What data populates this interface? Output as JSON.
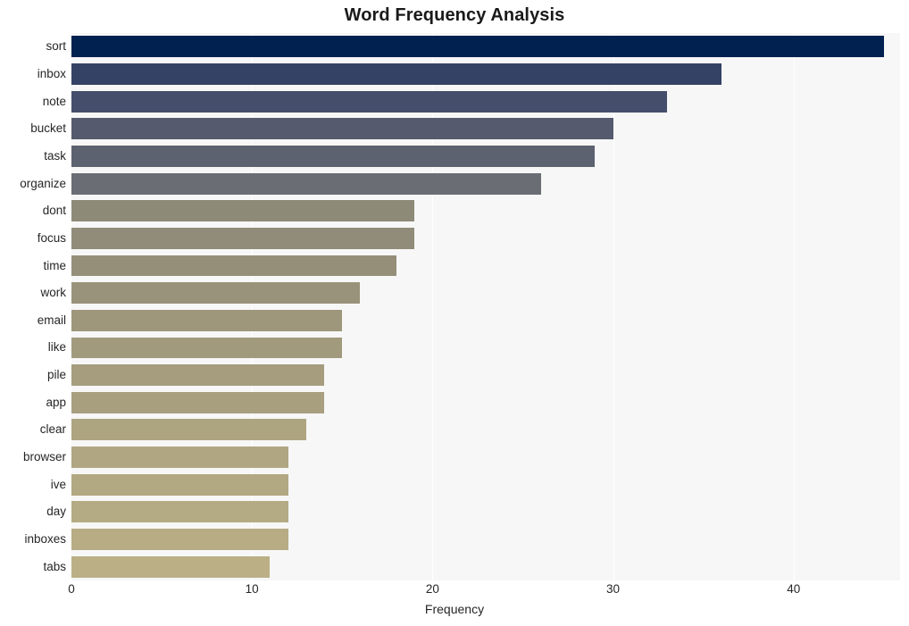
{
  "chart_data": {
    "type": "bar",
    "orientation": "horizontal",
    "title": "Word Frequency Analysis",
    "xlabel": "Frequency",
    "ylabel": "",
    "categories": [
      "sort",
      "inbox",
      "note",
      "bucket",
      "task",
      "organize",
      "dont",
      "focus",
      "time",
      "work",
      "email",
      "like",
      "pile",
      "app",
      "clear",
      "browser",
      "ive",
      "day",
      "inboxes",
      "tabs"
    ],
    "values": [
      45,
      36,
      33,
      30,
      29,
      26,
      19,
      19,
      18,
      16,
      15,
      15,
      14,
      14,
      13,
      12,
      12,
      12,
      12,
      11
    ],
    "bar_colors": [
      "#012151",
      "#344265",
      "#454f6c",
      "#555a6e",
      "#5d6270",
      "#6b6d75",
      "#8e8a78",
      "#918c79",
      "#958f79",
      "#9a937b",
      "#9e977c",
      "#a19a7d",
      "#a59d7e",
      "#a89f7f",
      "#ada480",
      "#b0a681",
      "#b2a882",
      "#b4aa83",
      "#b7ac84",
      "#bbaf86"
    ],
    "xlim": [
      0,
      45.9
    ],
    "xticks": [
      0,
      10,
      20,
      30,
      40
    ],
    "xtick_labels": [
      "0",
      "10",
      "20",
      "30",
      "40"
    ],
    "grid": true,
    "grid_axis": "x",
    "grid_color": "#ffffff",
    "plot_background": "#f7f7f7",
    "figure_background": "#ffffff",
    "legend": null
  }
}
